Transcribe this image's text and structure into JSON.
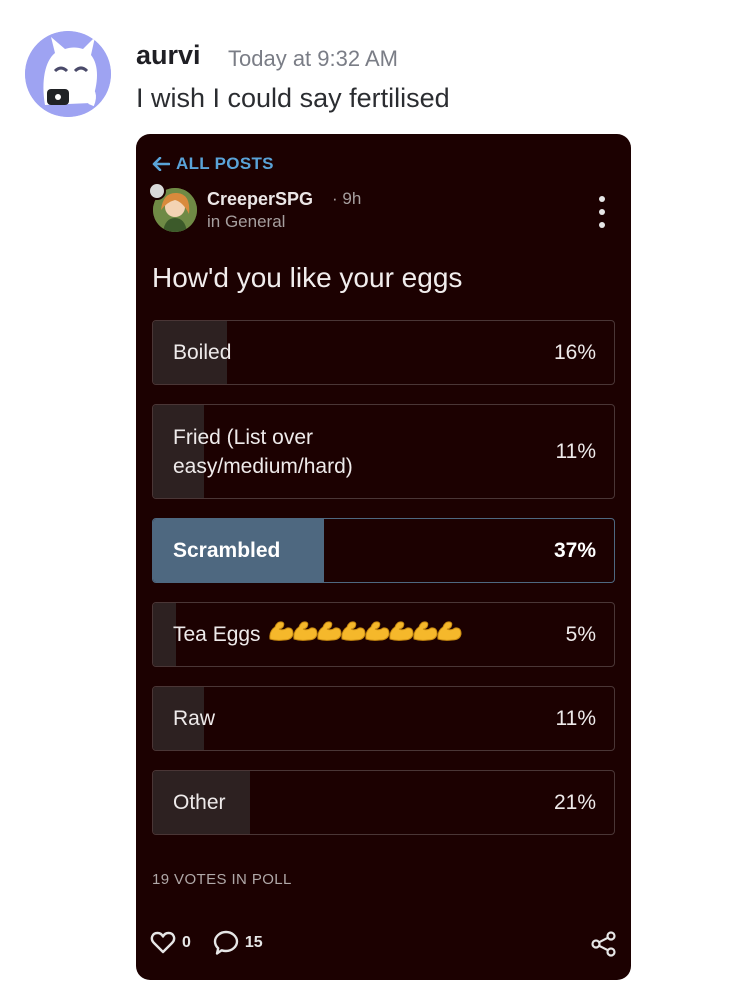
{
  "message": {
    "username": "aurvi",
    "timestamp": "Today at 9:32 AM",
    "text": "I wish I could say fertilised"
  },
  "post": {
    "back_label": "ALL POSTS",
    "author": "CreeperSPG",
    "time": "9h",
    "community": "in General",
    "question": "How'd you like your eggs",
    "options": [
      {
        "label": "Boiled",
        "percent": "16%",
        "value": 0.16
      },
      {
        "label": "Fried (List over easy/medium/hard)",
        "percent": "11%",
        "value": 0.11
      },
      {
        "label": "Scrambled",
        "percent": "37%",
        "value": 0.37,
        "selected": true
      },
      {
        "label": "Tea Eggs",
        "percent": "5%",
        "value": 0.05
      },
      {
        "label": "Raw",
        "percent": "11%",
        "value": 0.11
      },
      {
        "label": "Other",
        "percent": "21%",
        "value": 0.21
      }
    ],
    "votes_label": "19 VOTES IN POLL",
    "likes": "0",
    "comments": "15"
  },
  "colors": {
    "card_bg": "#1c0101",
    "accent_blue": "#5aa3d8",
    "selected_fill": "#4e6880",
    "flex_emoji": "#f5b82b"
  },
  "icons": {
    "back": "arrow-left-icon",
    "menu": "more-vertical-icon",
    "like": "heart-icon",
    "comment": "comment-bubble-icon",
    "share": "share-icon",
    "emoji": "flexed-biceps-emoji"
  }
}
